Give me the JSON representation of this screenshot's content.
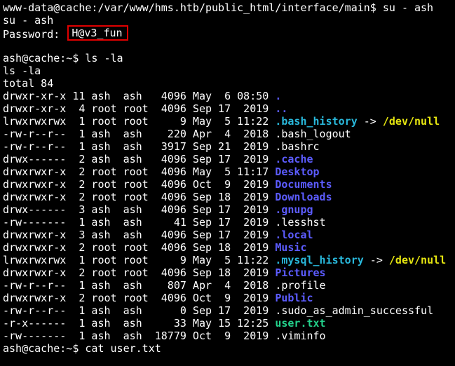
{
  "session": {
    "prompt_cmd": "www-data@cache:/var/www/hms.htb/public_html/interface/main$ su - ash",
    "echo_cmd": "su - ash",
    "password_label": "Password: ",
    "password_value": "H@v3_fun",
    "prompt2": "ash@cache:~$ ls -la",
    "echo_ls": "ls -la",
    "total": "total 84",
    "last_prompt": "ash@cache:~$ cat user.txt"
  },
  "colors": {
    "directory": "#5c5cff",
    "symlink": "#29b8db",
    "executable": "#23d18b",
    "symlink_target": "#e5e510",
    "highlight_box": "#e00000"
  },
  "listing": [
    {
      "meta": "drwxr-xr-x 11 ash  ash   4096 May  6 08:50 ",
      "name": ".",
      "type": "dir"
    },
    {
      "meta": "drwxr-xr-x  4 root root  4096 Sep 17  2019 ",
      "name": "..",
      "type": "dir"
    },
    {
      "meta": "lrwxrwxrwx  1 root root     9 May  5 11:22 ",
      "name": ".bash_history",
      "type": "link",
      "arrow": " -> ",
      "target": "/dev/null"
    },
    {
      "meta": "-rw-r--r--  1 ash  ash    220 Apr  4  2018 ",
      "name": ".bash_logout",
      "type": "file"
    },
    {
      "meta": "-rw-r--r--  1 ash  ash   3917 Sep 21  2019 ",
      "name": ".bashrc",
      "type": "file"
    },
    {
      "meta": "drwx------  2 ash  ash   4096 Sep 17  2019 ",
      "name": ".cache",
      "type": "dir"
    },
    {
      "meta": "drwxrwxr-x  2 root root  4096 May  5 11:17 ",
      "name": "Desktop",
      "type": "dir"
    },
    {
      "meta": "drwxrwxr-x  2 root root  4096 Oct  9  2019 ",
      "name": "Documents",
      "type": "dir"
    },
    {
      "meta": "drwxrwxr-x  2 root root  4096 Sep 18  2019 ",
      "name": "Downloads",
      "type": "dir"
    },
    {
      "meta": "drwx------  3 ash  ash   4096 Sep 17  2019 ",
      "name": ".gnupg",
      "type": "dir"
    },
    {
      "meta": "-rw-------  1 ash  ash     41 Sep 17  2019 ",
      "name": ".lesshst",
      "type": "file"
    },
    {
      "meta": "drwxrwxr-x  3 ash  ash   4096 Sep 17  2019 ",
      "name": ".local",
      "type": "dir"
    },
    {
      "meta": "drwxrwxr-x  2 root root  4096 Sep 18  2019 ",
      "name": "Music",
      "type": "dir"
    },
    {
      "meta": "lrwxrwxrwx  1 root root     9 May  5 11:22 ",
      "name": ".mysql_history",
      "type": "link",
      "arrow": " -> ",
      "target": "/dev/null"
    },
    {
      "meta": "drwxrwxr-x  2 root root  4096 Sep 18  2019 ",
      "name": "Pictures",
      "type": "dir"
    },
    {
      "meta": "-rw-r--r--  1 ash  ash    807 Apr  4  2018 ",
      "name": ".profile",
      "type": "file"
    },
    {
      "meta": "drwxrwxr-x  2 root root  4096 Oct  9  2019 ",
      "name": "Public",
      "type": "dir"
    },
    {
      "meta": "-rw-r--r--  1 ash  ash      0 Sep 17  2019 ",
      "name": ".sudo_as_admin_successful",
      "type": "file"
    },
    {
      "meta": "-r-x------  1 ash  ash     33 May 15 12:25 ",
      "name": "user.txt",
      "type": "exec"
    },
    {
      "meta": "-rw-------  1 ash  ash  18779 Oct  9  2019 ",
      "name": ".viminfo",
      "type": "file"
    }
  ]
}
